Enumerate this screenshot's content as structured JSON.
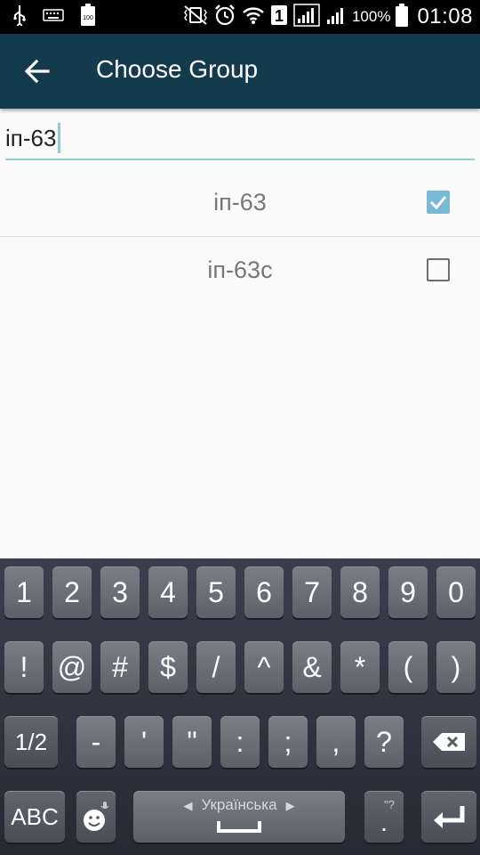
{
  "status_bar": {
    "battery_percent": "100%",
    "time": "01:08",
    "sim_slot": "1",
    "battery_small_label": "100"
  },
  "app_bar": {
    "title": "Choose Group"
  },
  "search": {
    "value": "іп-63"
  },
  "groups": [
    {
      "label": "іп-63",
      "checked": true
    },
    {
      "label": "іп-63с",
      "checked": false
    }
  ],
  "keyboard": {
    "row1": [
      "1",
      "2",
      "3",
      "4",
      "5",
      "6",
      "7",
      "8",
      "9",
      "0"
    ],
    "row2": [
      "!",
      "@",
      "#",
      "$",
      "/",
      "^",
      "&",
      "*",
      "(",
      ")"
    ],
    "row3": [
      "1/2",
      "-",
      "'",
      "\"",
      ":",
      ";",
      ",",
      "?"
    ],
    "abc": "ABC",
    "language": "Українська",
    "period": ".",
    "period_hint": "\"?"
  },
  "colors": {
    "app_bar": "#133a4d",
    "accent": "#8fcbd6",
    "checkbox": "#7ab9d6"
  }
}
